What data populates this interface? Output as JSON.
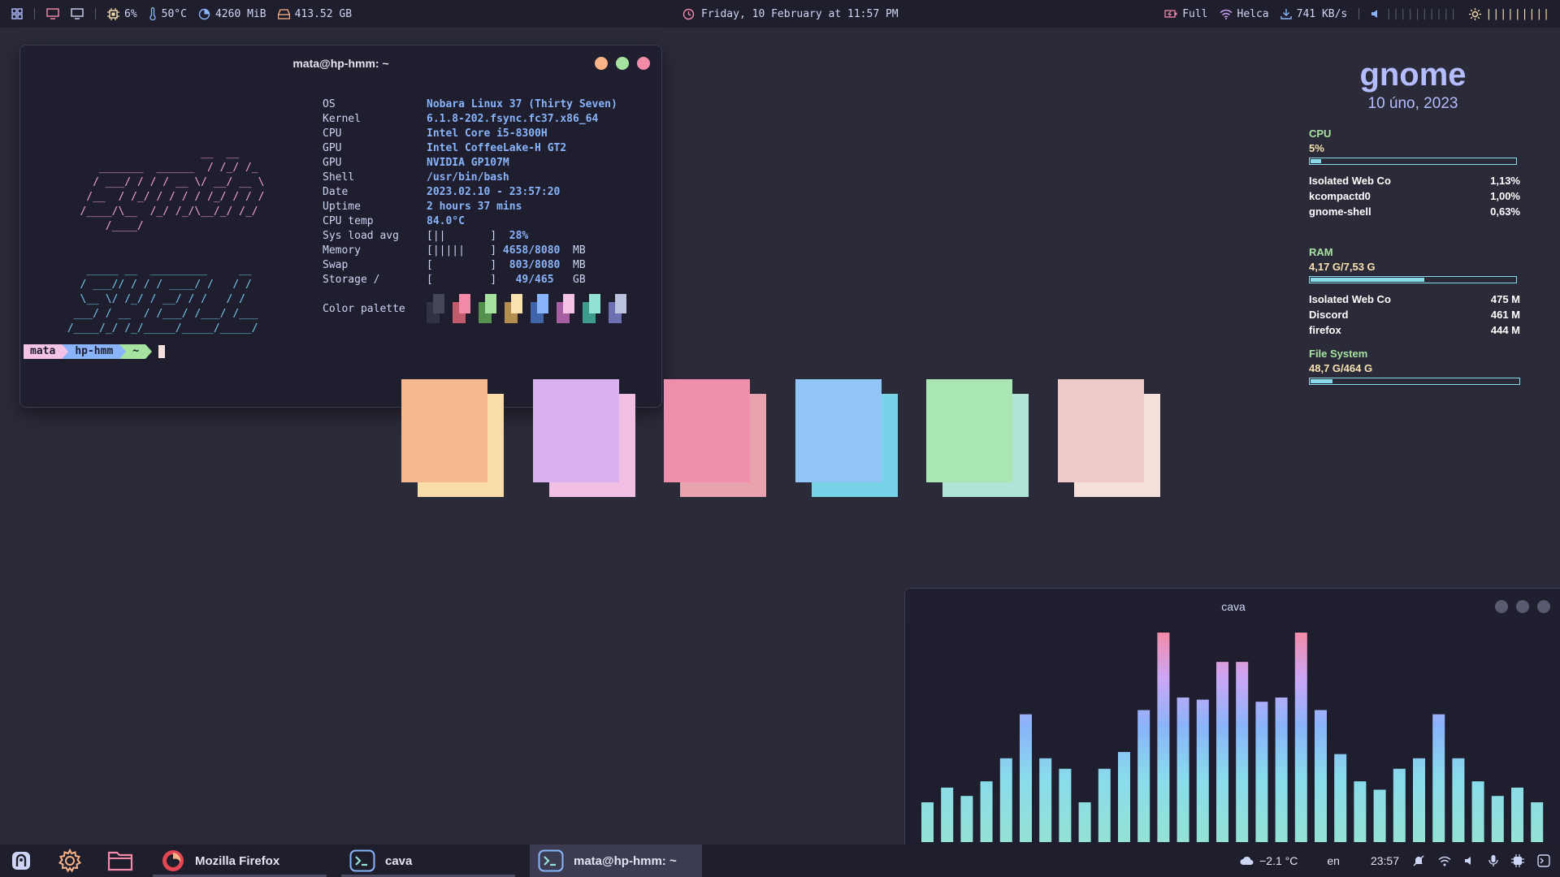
{
  "topbar": {
    "cpu": "6%",
    "temp": "50°C",
    "memory": "4260 MiB",
    "disk": "413.52 GB",
    "datetime": "Friday, 10 February at 11:57 PM",
    "battery": "Full",
    "wifi": "Helca",
    "netspeed": "741 KB/s",
    "volume_bars": "||||||||||",
    "brightness_bars": "|||||||||",
    "colors": {
      "red": "#f38ba8",
      "yellow": "#f9e2af",
      "blue": "#89b4fa",
      "teal": "#94e2d5"
    }
  },
  "terminal": {
    "title": "mata@hp-hmm: ~",
    "buttons": {
      "minimize": "#fab387",
      "maximize": "#a6e3a1",
      "close": "#f38ba8"
    },
    "ascii_pink": [
      "                      __  __",
      "      _______  ______  / /_/ /_",
      "     / ___/ / / / __ \\/ __/ __ \\",
      "    /__  / /_/ / / / / /_/ / / /",
      "   /____/\\__  /_/ /_/\\__/_/ /_/",
      "       /____/"
    ],
    "ascii_cyan": [
      "    _____ __  _________     __",
      "   / ___// / / / ____/ /   / /",
      "   \\__ \\/ /_/ / __/ / /   / /",
      "  ___/ / __  / /___/ /___/ /___",
      " /____/_/ /_/_____/_____/_____/"
    ],
    "info": [
      {
        "k": "OS",
        "v": "Nobara Linux 37 (Thirty Seven)"
      },
      {
        "k": "Kernel",
        "v": "6.1.8-202.fsync.fc37.x86_64"
      },
      {
        "k": "CPU",
        "v": "Intel Core i5-8300H"
      },
      {
        "k": "GPU",
        "v": "Intel CoffeeLake-H GT2"
      },
      {
        "k": "GPU",
        "v": "NVIDIA GP107M"
      },
      {
        "k": "Shell",
        "v": "/usr/bin/bash"
      },
      {
        "k": "Date",
        "v": "2023.02.10 - 23:57:20"
      },
      {
        "k": "Uptime",
        "v": "2 hours 37 mins"
      },
      {
        "k": "CPU temp",
        "v": "84.0°C"
      }
    ],
    "meters": [
      {
        "k": "Sys load avg",
        "bar": "[||       ]",
        "val": "  28%",
        "unit": ""
      },
      {
        "k": "Memory",
        "bar": "[|||||    ]",
        "val": " 4658/8080",
        "unit": "  MB"
      },
      {
        "k": "Swap",
        "bar": "[         ]",
        "val": "  803/8080",
        "unit": "  MB"
      },
      {
        "k": "Storage /",
        "bar": "[         ]",
        "val": "   49/465",
        "unit": "   GB"
      }
    ],
    "palette_label": "Color palette",
    "palette": [
      [
        "#313244",
        "#45475a"
      ],
      [
        "#c25c6c",
        "#f38ba8"
      ],
      [
        "#55904f",
        "#a6e3a1"
      ],
      [
        "#b38e4e",
        "#f9e2af"
      ],
      [
        "#3f64a8",
        "#89b4fa"
      ],
      [
        "#a65fa0",
        "#f5c2e7"
      ],
      [
        "#3f9c8c",
        "#94e2d5"
      ],
      [
        "#6c6fb0",
        "#bac2de"
      ]
    ],
    "prompt": {
      "user": "mata",
      "host": "hp-hmm",
      "dir": "~"
    }
  },
  "squares": [
    {
      "back": "#f9dca8",
      "front": "#f5b98f"
    },
    {
      "back": "#f1bfe4",
      "front": "#dcb1ef"
    },
    {
      "back": "#e8a3ae",
      "front": "#ef8fab"
    },
    {
      "back": "#77d4e8",
      "front": "#90c5f6"
    },
    {
      "back": "#b0e4d9",
      "front": "#a9e6b4"
    },
    {
      "back": "#f5e0dc",
      "front": "#efcaca"
    }
  ],
  "conky": {
    "title": "gnome",
    "date": "10 úno, 2023",
    "cpu": {
      "label": "CPU",
      "value": "5%",
      "fill": 0.05,
      "procs": [
        {
          "name": "Isolated Web Co",
          "val": "1,13%"
        },
        {
          "name": "kcompactd0",
          "val": "1,00%"
        },
        {
          "name": "gnome-shell",
          "val": "0,63%"
        }
      ]
    },
    "ram": {
      "label": "RAM",
      "value": "4,17 G/7,53 G",
      "fill": 0.554,
      "procs": [
        {
          "name": "Isolated Web Co",
          "val": "475 M"
        },
        {
          "name": "Discord",
          "val": "461 M"
        },
        {
          "name": "firefox",
          "val": "444 M"
        }
      ]
    },
    "fs": {
      "label": "File System",
      "value": "48,7 G/464 G",
      "fill": 0.105
    }
  },
  "cava": {
    "title": "cava",
    "levels": [
      0.19,
      0.26,
      0.22,
      0.29,
      0.4,
      0.61,
      0.4,
      0.35,
      0.19,
      0.35,
      0.43,
      0.63,
      1.0,
      0.69,
      0.68,
      0.86,
      0.86,
      0.67,
      0.69,
      1.0,
      0.63,
      0.42,
      0.29,
      0.25,
      0.35,
      0.4,
      0.61,
      0.4,
      0.29,
      0.22,
      0.26,
      0.19
    ]
  },
  "taskbar": {
    "tasks": [
      {
        "label": "Mozilla Firefox"
      },
      {
        "label": "cava"
      },
      {
        "label": "mata@hp-hmm: ~"
      }
    ],
    "weather": "−2.1 °C",
    "lang": "en",
    "time": "23:57"
  }
}
